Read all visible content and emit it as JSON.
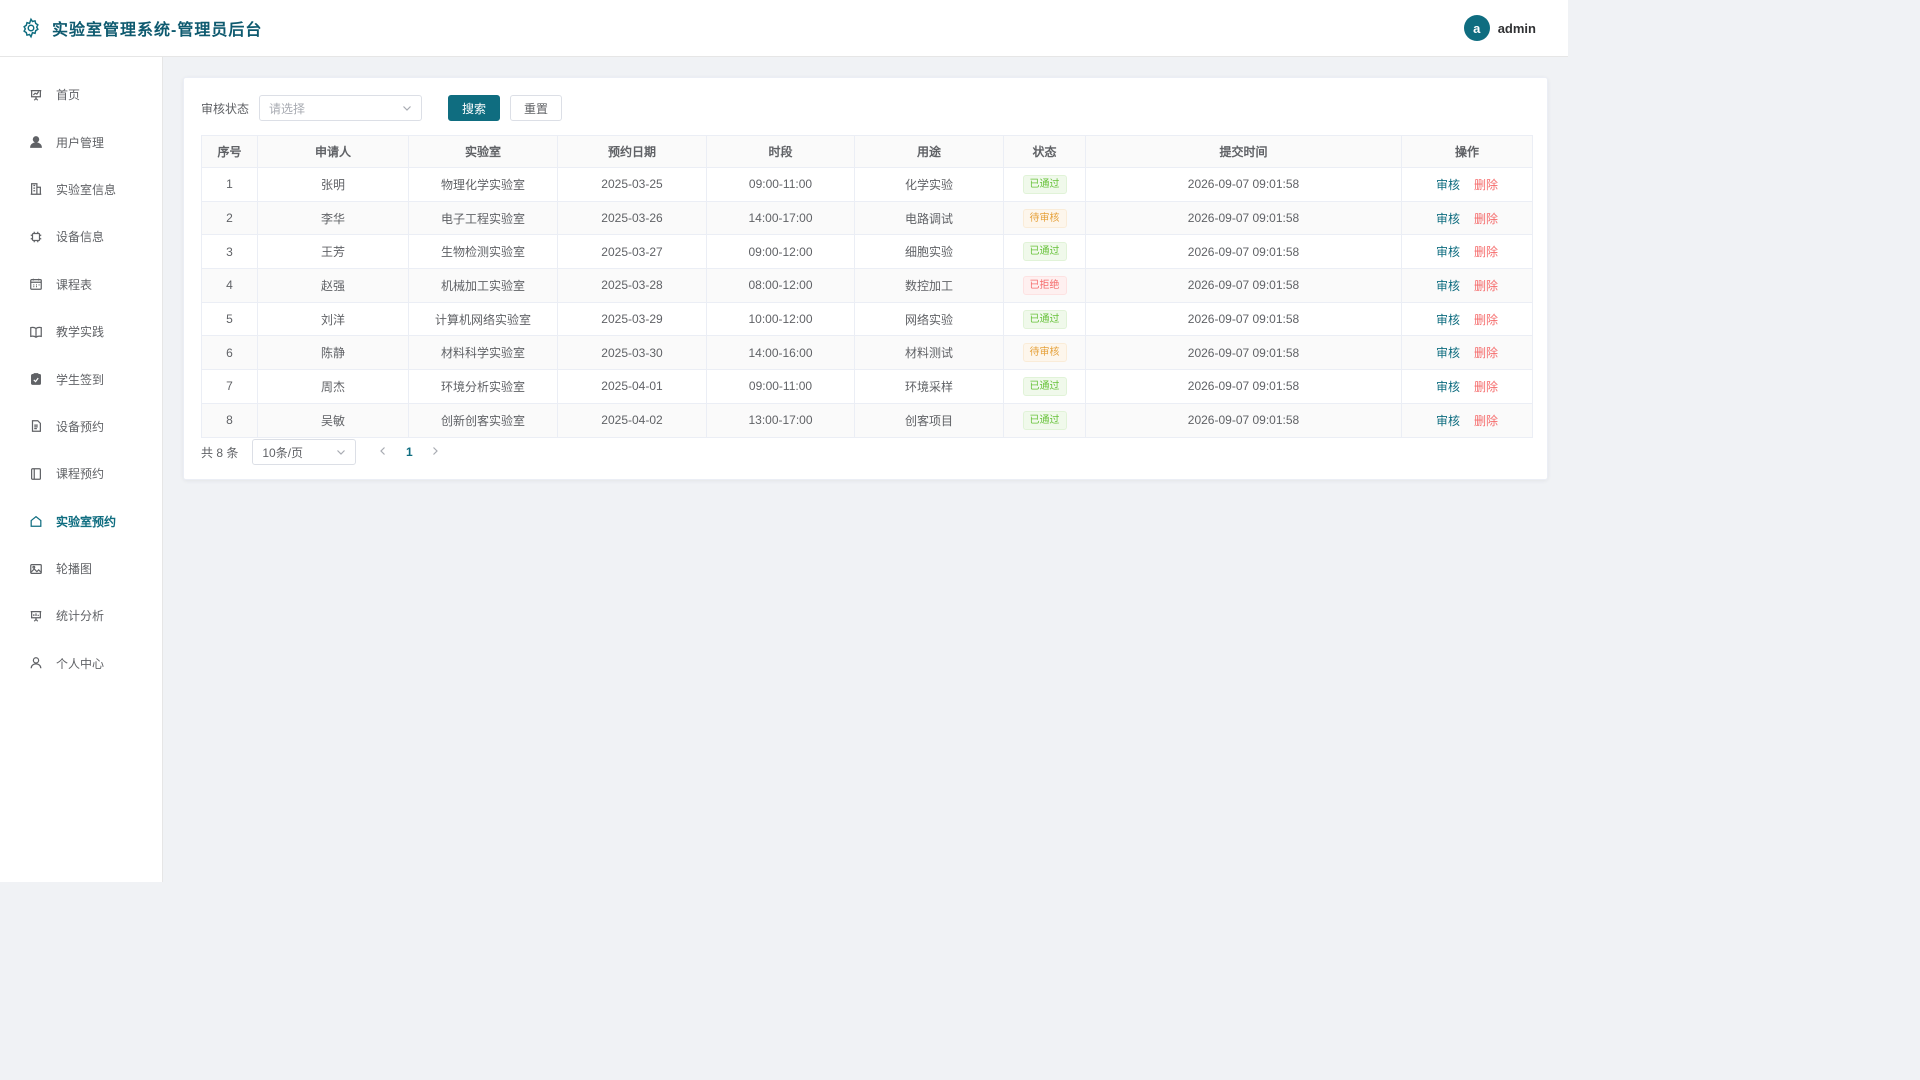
{
  "header": {
    "title": "实验室管理系统-管理员后台",
    "user": {
      "avatar_letter": "a",
      "name": "admin"
    }
  },
  "sidebar": {
    "items": [
      {
        "label": "首页",
        "icon": "presentation-icon"
      },
      {
        "label": "用户管理",
        "icon": "user-icon"
      },
      {
        "label": "实验室信息",
        "icon": "building-icon"
      },
      {
        "label": "设备信息",
        "icon": "chip-icon"
      },
      {
        "label": "课程表",
        "icon": "calendar-icon"
      },
      {
        "label": "教学实践",
        "icon": "book-icon"
      },
      {
        "label": "学生签到",
        "icon": "clipboard-check-icon"
      },
      {
        "label": "设备预约",
        "icon": "document-icon"
      },
      {
        "label": "课程预约",
        "icon": "notebook-icon"
      },
      {
        "label": "实验室预约",
        "icon": "house-icon",
        "active": true
      },
      {
        "label": "轮播图",
        "icon": "picture-icon"
      },
      {
        "label": "统计分析",
        "icon": "chart-board-icon"
      },
      {
        "label": "个人中心",
        "icon": "user-outline-icon"
      }
    ]
  },
  "filter": {
    "status_label": "审核状态",
    "status_placeholder": "请选择",
    "search_label": "搜索",
    "reset_label": "重置"
  },
  "table": {
    "columns": [
      "序号",
      "申请人",
      "实验室",
      "预约日期",
      "时段",
      "用途",
      "状态",
      "提交时间",
      "操作"
    ],
    "rows": [
      {
        "index": "1",
        "applicant": "张明",
        "lab": "物理化学实验室",
        "date": "2025-03-25",
        "slot": "09:00-11:00",
        "purpose": "化学实验",
        "status": "已通过",
        "status_type": "approved",
        "submitted": "2026-09-07 09:01:58"
      },
      {
        "index": "2",
        "applicant": "李华",
        "lab": "电子工程实验室",
        "date": "2025-03-26",
        "slot": "14:00-17:00",
        "purpose": "电路调试",
        "status": "待审核",
        "status_type": "pending",
        "submitted": "2026-09-07 09:01:58"
      },
      {
        "index": "3",
        "applicant": "王芳",
        "lab": "生物检测实验室",
        "date": "2025-03-27",
        "slot": "09:00-12:00",
        "purpose": "细胞实验",
        "status": "已通过",
        "status_type": "approved",
        "submitted": "2026-09-07 09:01:58"
      },
      {
        "index": "4",
        "applicant": "赵强",
        "lab": "机械加工实验室",
        "date": "2025-03-28",
        "slot": "08:00-12:00",
        "purpose": "数控加工",
        "status": "已拒绝",
        "status_type": "rejected",
        "submitted": "2026-09-07 09:01:58"
      },
      {
        "index": "5",
        "applicant": "刘洋",
        "lab": "计算机网络实验室",
        "date": "2025-03-29",
        "slot": "10:00-12:00",
        "purpose": "网络实验",
        "status": "已通过",
        "status_type": "approved",
        "submitted": "2026-09-07 09:01:58"
      },
      {
        "index": "6",
        "applicant": "陈静",
        "lab": "材料科学实验室",
        "date": "2025-03-30",
        "slot": "14:00-16:00",
        "purpose": "材料测试",
        "status": "待审核",
        "status_type": "pending",
        "submitted": "2026-09-07 09:01:58"
      },
      {
        "index": "7",
        "applicant": "周杰",
        "lab": "环境分析实验室",
        "date": "2025-04-01",
        "slot": "09:00-11:00",
        "purpose": "环境采样",
        "status": "已通过",
        "status_type": "approved",
        "submitted": "2026-09-07 09:01:58"
      },
      {
        "index": "8",
        "applicant": "吴敏",
        "lab": "创新创客实验室",
        "date": "2025-04-02",
        "slot": "13:00-17:00",
        "purpose": "创客项目",
        "status": "已通过",
        "status_type": "approved",
        "submitted": "2026-09-07 09:01:58"
      }
    ],
    "actions": {
      "review": "审核",
      "delete": "删除"
    }
  },
  "pagination": {
    "total_text": "共 8 条",
    "page_size": "10条/页",
    "current_page": "1"
  },
  "colors": {
    "primary": "#0f6d80",
    "approved": "#67c23a",
    "pending": "#e6a23c",
    "rejected": "#f56c6c"
  }
}
